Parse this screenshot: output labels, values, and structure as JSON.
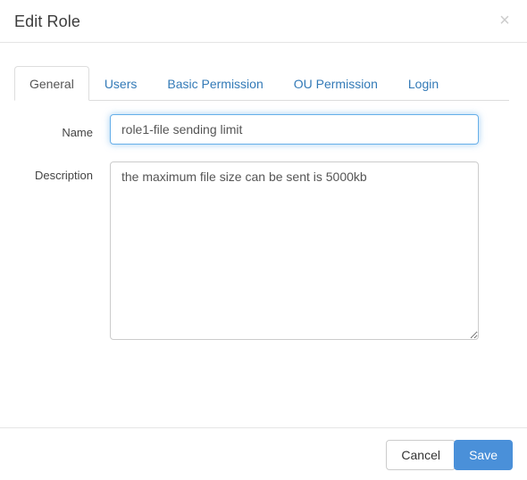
{
  "dialog": {
    "title": "Edit Role",
    "close_icon": "close-icon",
    "close_label": "×"
  },
  "tabs": [
    {
      "label": "General",
      "active": true
    },
    {
      "label": "Users",
      "active": false
    },
    {
      "label": "Basic Permission",
      "active": false
    },
    {
      "label": "OU Permission",
      "active": false
    },
    {
      "label": "Login",
      "active": false
    }
  ],
  "form": {
    "name": {
      "label": "Name",
      "value": "role1-file sending limit",
      "placeholder": ""
    },
    "description": {
      "label": "Description",
      "value": "the maximum file size can be sent is 5000kb",
      "placeholder": ""
    }
  },
  "footer": {
    "cancel_label": "Cancel",
    "save_label": "Save"
  },
  "colors": {
    "link": "#337ab7",
    "primary": "#4a90d9",
    "focus_border": "#66afe9",
    "border": "#cccccc",
    "divider": "#e5e5e5",
    "text": "#555555",
    "title": "#3c3c3c"
  }
}
